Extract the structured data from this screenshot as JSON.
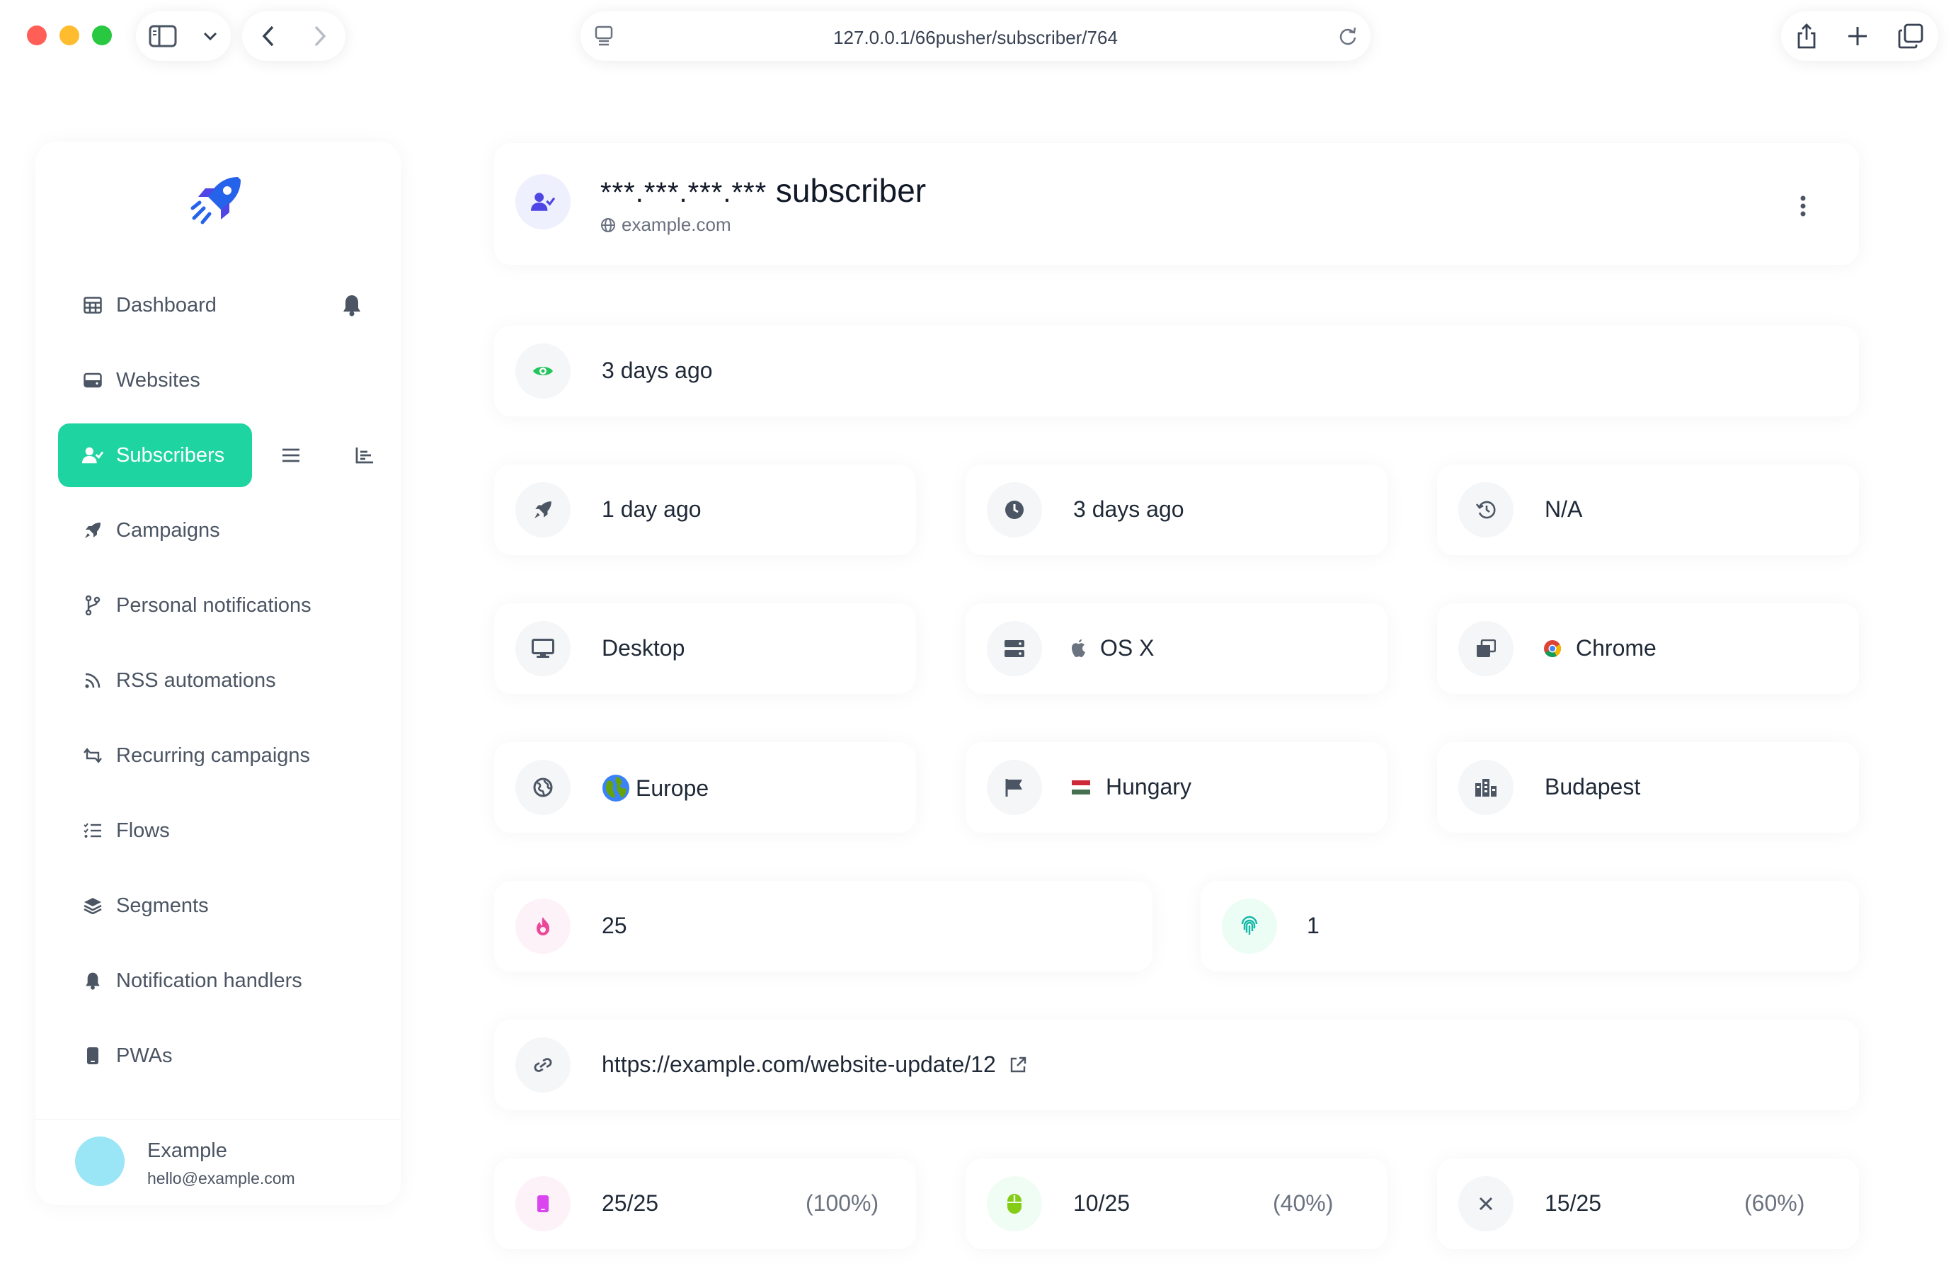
{
  "browser": {
    "url": "127.0.0.1/66pusher/subscriber/764"
  },
  "sidebar": {
    "items": [
      {
        "label": "Dashboard",
        "icon": "table-icon"
      },
      {
        "label": "Websites",
        "icon": "hdd-icon"
      },
      {
        "label": "Subscribers",
        "icon": "user-check-icon",
        "active": true
      },
      {
        "label": "Campaigns",
        "icon": "rocket-icon"
      },
      {
        "label": "Personal notifications",
        "icon": "code-branch-icon"
      },
      {
        "label": "RSS automations",
        "icon": "rss-icon"
      },
      {
        "label": "Recurring campaigns",
        "icon": "retweet-icon"
      },
      {
        "label": "Flows",
        "icon": "tasks-icon"
      },
      {
        "label": "Segments",
        "icon": "layer-group-icon"
      },
      {
        "label": "Notification handlers",
        "icon": "bell-icon"
      },
      {
        "label": "PWAs",
        "icon": "mobile-icon"
      }
    ],
    "user": {
      "name": "Example",
      "email": "hello@example.com"
    }
  },
  "header": {
    "ip_mask": "***.***.***.***",
    "title": "subscriber",
    "website": "example.com"
  },
  "details": {
    "last_seen": "3 days ago",
    "last_sent": "1 day ago",
    "subscribed": "3 days ago",
    "updated": "N/A",
    "device": "Desktop",
    "os": "OS X",
    "browser": "Chrome",
    "continent": "Europe",
    "country": "Hungary",
    "city": "Budapest",
    "total_notifications": "25",
    "unique_id": "1",
    "subscribed_url": "https://example.com/website-update/12"
  },
  "stats": {
    "displayed": {
      "value": "25/25",
      "percent": "(100%)"
    },
    "clicked": {
      "value": "10/25",
      "percent": "(40%)"
    },
    "closed": {
      "value": "15/25",
      "percent": "(60%)"
    }
  },
  "colors": {
    "accent": "#1ed4a0",
    "pink": "#ec4899",
    "green": "#84cc16",
    "teal": "#14b8a6",
    "indigo": "#4f46e5",
    "eye": "#22c55e"
  }
}
